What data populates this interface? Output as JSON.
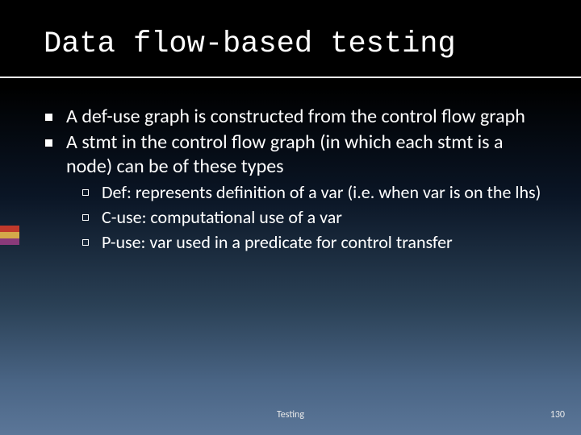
{
  "title": "Data flow-based testing",
  "bullets": [
    {
      "text": "A def-use graph is constructed from the control flow graph"
    },
    {
      "text": "A stmt in the control flow graph (in which each stmt is a node) can be of these types",
      "children": [
        {
          "text": "Def: represents definition of a var (i.e. when var is on the lhs)"
        },
        {
          "text": "C-use: computational use of a var"
        },
        {
          "text": "P-use: var used in a predicate for control transfer"
        }
      ]
    }
  ],
  "footer": {
    "center": "Testing",
    "page": "130"
  }
}
